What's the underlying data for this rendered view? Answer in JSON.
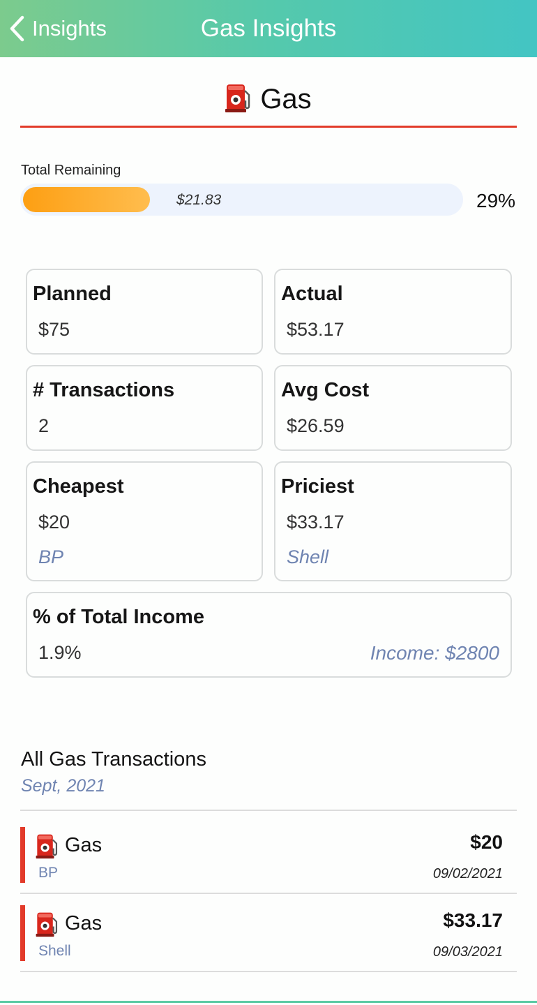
{
  "header": {
    "back_label": "Insights",
    "title": "Gas Insights",
    "gradient_start": "#7ccb8d",
    "gradient_end": "#43c5c3"
  },
  "category": {
    "icon": "fuel-pump-icon",
    "name": "Gas",
    "accent_color": "#e23b2a"
  },
  "remaining": {
    "label": "Total Remaining",
    "amount": "$21.83",
    "percent_text": "29%",
    "fill_fraction": 0.29,
    "fill_color": "#fd9f13"
  },
  "stats": {
    "planned": {
      "title": "Planned",
      "value": "$75"
    },
    "actual": {
      "title": "Actual",
      "value": "$53.17"
    },
    "transactions": {
      "title": "# Transactions",
      "value": "2"
    },
    "avg_cost": {
      "title": "Avg Cost",
      "value": "$26.59"
    },
    "cheapest": {
      "title": "Cheapest",
      "value": "$20",
      "merchant": "BP"
    },
    "priciest": {
      "title": "Priciest",
      "value": "$33.17",
      "merchant": "Shell"
    },
    "income_share": {
      "title": "% of Total Income",
      "value": "1.9%",
      "income": "Income: $2800"
    }
  },
  "transactions": {
    "heading": "All Gas Transactions",
    "period": "Sept, 2021",
    "items": [
      {
        "category": "Gas",
        "merchant": "BP",
        "amount": "$20",
        "date": "09/02/2021"
      },
      {
        "category": "Gas",
        "merchant": "Shell",
        "amount": "$33.17",
        "date": "09/03/2021"
      }
    ]
  }
}
